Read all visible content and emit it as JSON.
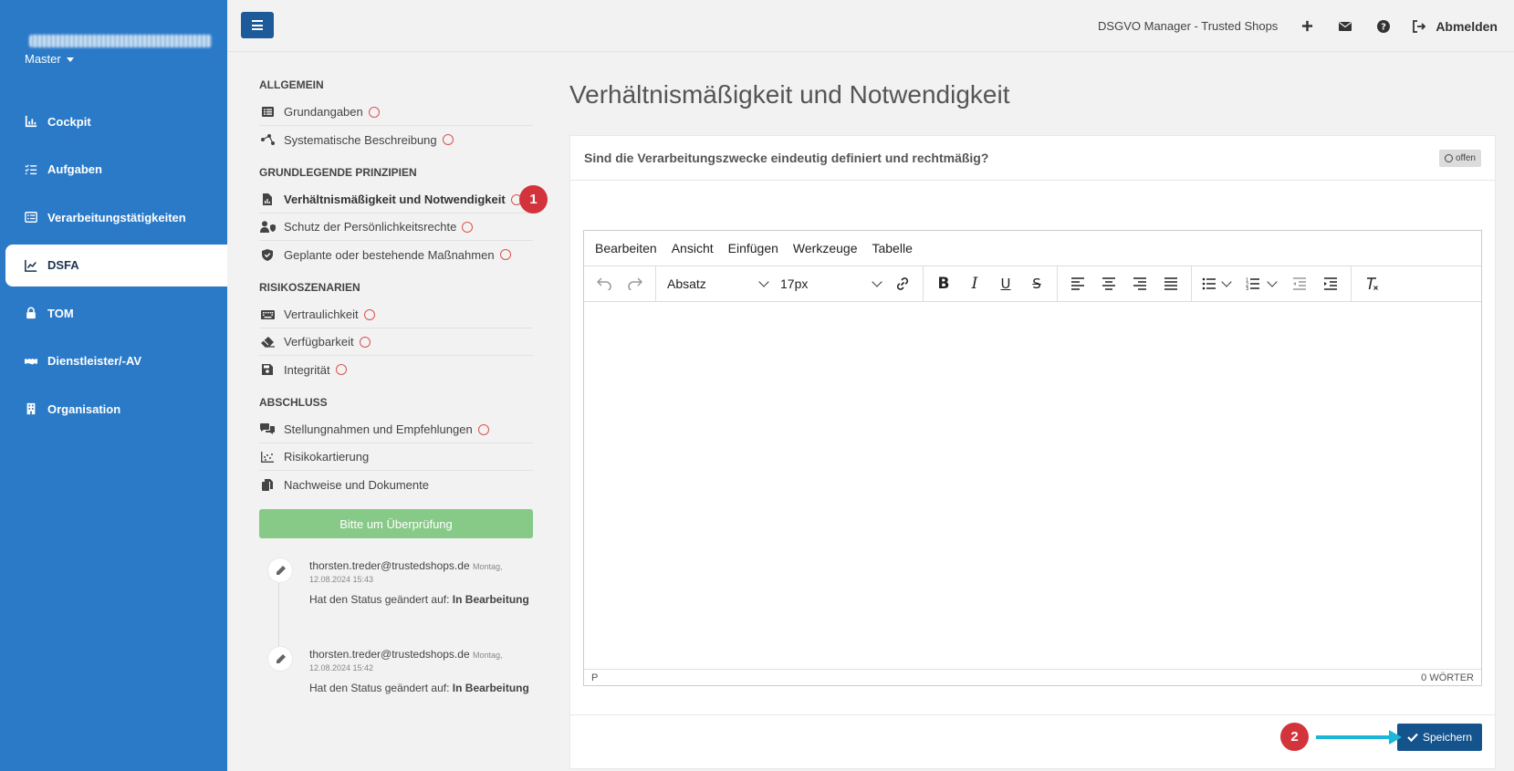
{
  "sidebar": {
    "tenant": "Master",
    "items": [
      {
        "label": "Cockpit",
        "icon": "chart-bar-icon"
      },
      {
        "label": "Aufgaben",
        "icon": "list-check-icon"
      },
      {
        "label": "Verarbeitungstätigkeiten",
        "icon": "list-icon"
      },
      {
        "label": "DSFA",
        "icon": "chart-line-icon",
        "active": true
      },
      {
        "label": "TOM",
        "icon": "lock-icon"
      },
      {
        "label": "Dienstleister/-AV",
        "icon": "handshake-icon"
      },
      {
        "label": "Organisation",
        "icon": "building-icon"
      }
    ]
  },
  "header": {
    "app_title": "DSGVO Manager - Trusted Shops",
    "logout_label": "Abmelden"
  },
  "sections": [
    {
      "heading": "ALLGEMEIN",
      "items": [
        {
          "label": "Grundangaben",
          "icon": "list-alt-icon",
          "status": "open"
        },
        {
          "label": "Systematische Beschreibung",
          "icon": "project-diagram-icon",
          "status": "open"
        }
      ]
    },
    {
      "heading": "GRUNDLEGENDE PRINZIPIEN",
      "items": [
        {
          "label": "Verhältnismäßigkeit und Notwendigkeit",
          "icon": "file-chart-icon",
          "status": "open",
          "active": true
        },
        {
          "label": "Schutz der Persönlichkeitsrechte",
          "icon": "user-shield-icon",
          "status": "open"
        },
        {
          "label": "Geplante oder bestehende Maßnahmen",
          "icon": "shield-check-icon",
          "status": "open"
        }
      ]
    },
    {
      "heading": "RISIKOSZENARIEN",
      "items": [
        {
          "label": "Vertraulichkeit",
          "icon": "keyboard-icon",
          "status": "open"
        },
        {
          "label": "Verfügbarkeit",
          "icon": "eraser-icon",
          "status": "open"
        },
        {
          "label": "Integrität",
          "icon": "save-icon",
          "status": "open"
        }
      ]
    },
    {
      "heading": "ABSCHLUSS",
      "items": [
        {
          "label": "Stellungnahmen und Empfehlungen",
          "icon": "comments-icon",
          "status": "open"
        },
        {
          "label": "Risikokartierung",
          "icon": "scatter-chart-icon"
        },
        {
          "label": "Nachweise und Dokumente",
          "icon": "copy-icon"
        }
      ]
    }
  ],
  "review_button": "Bitte um Überprüfung",
  "timeline": [
    {
      "user": "thorsten.treder@trustedshops.de",
      "date_line1": "Montag,",
      "date_line2": "12.08.2024 15:43",
      "message": "Hat den Status geändert auf:",
      "status": "In Bearbeitung"
    },
    {
      "user": "thorsten.treder@trustedshops.de",
      "date_line1": "Montag,",
      "date_line2": "12.08.2024 15:42",
      "message": "Hat den Status geändert auf:",
      "status": "In Bearbeitung"
    }
  ],
  "main": {
    "title": "Verhältnismäßigkeit und Notwendigkeit",
    "question": "Sind die Verarbeitungszwecke eindeutig definiert und rechtmäßig?",
    "status_label": "offen"
  },
  "editor": {
    "menus": [
      "Bearbeiten",
      "Ansicht",
      "Einfügen",
      "Werkzeuge",
      "Tabelle"
    ],
    "block_format": "Absatz",
    "font_size": "17px",
    "path": "P",
    "word_count": "0 WÖRTER"
  },
  "save_label": "Speichern",
  "annotations": {
    "one": "1",
    "two": "2"
  },
  "colors": {
    "sidebar": "#2a7ac8",
    "primary": "#15538d",
    "success": "#87c987",
    "danger": "#d3333b",
    "arrow": "#1bb7d8"
  }
}
